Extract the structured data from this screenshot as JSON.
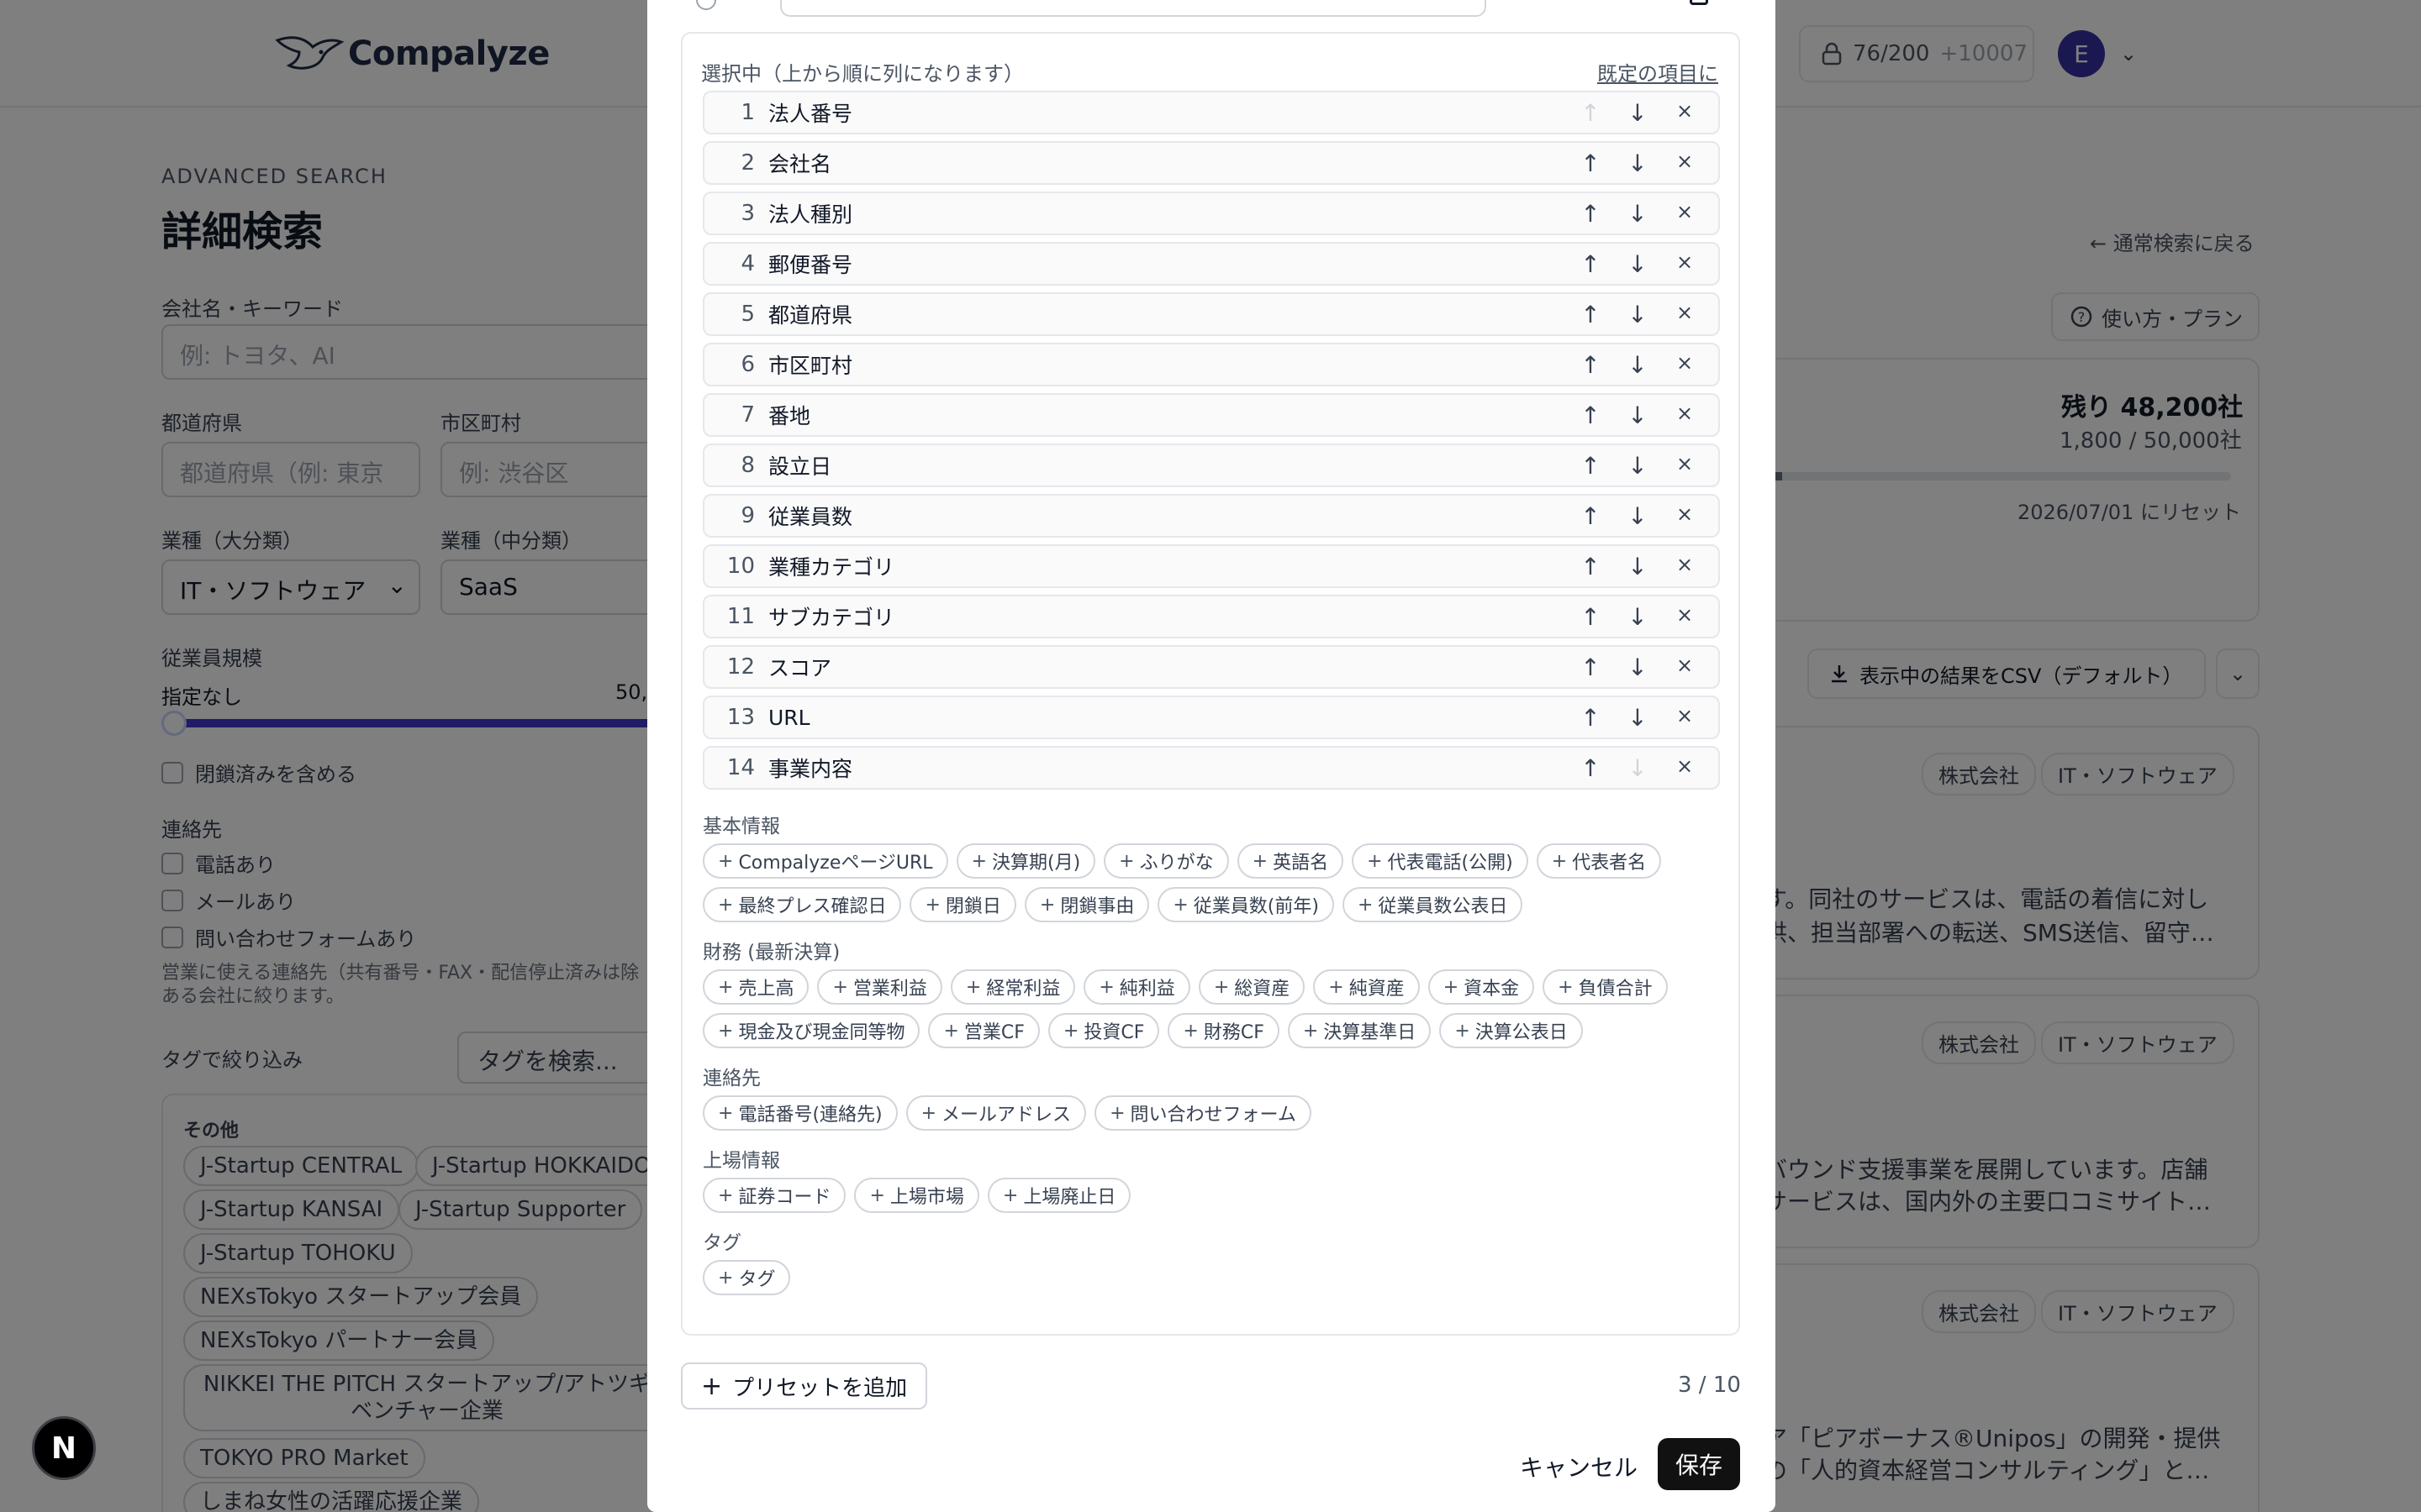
{
  "header": {
    "logo_text": "Compalyze",
    "credits": "76/200",
    "credits_extra": "+10007",
    "avatar_initial": "E"
  },
  "page": {
    "eyebrow": "ADVANCED SEARCH",
    "title": "詳細検索",
    "keyword_label": "会社名・キーワード",
    "keyword_placeholder": "例: トヨタ、AI",
    "pref_label": "都道府県",
    "pref_placeholder": "都道府県（例: 東京",
    "city_label": "市区町村",
    "city_placeholder": "例: 渋谷区",
    "industry_label": "業種（大分類）",
    "industry_value": "IT・ソフトウェア",
    "subindustry_label": "業種（中分類）",
    "subindustry_value": "SaaS",
    "employees_label": "従業員規模",
    "employees_min": "指定なし",
    "employees_max": "50,",
    "include_closed": "閉鎖済みを含める",
    "contact_label": "連絡先",
    "has_phone": "電話あり",
    "has_email": "メールあり",
    "has_form": "問い合わせフォームあり",
    "contact_note_1": "営業に使える連絡先（共有番号・FAX・配信停止済みは除",
    "contact_note_2": "ある会社に絞ります。",
    "tag_filter_label": "タグで絞り込み",
    "tag_search_placeholder": "タグを検索...",
    "tag_group_title": "その他",
    "tags": [
      "J-Startup CENTRAL",
      "J-Startup HOKKAIDO",
      "J-Startup KANSAI",
      "J-Startup Supporter",
      "J-Startup TOHOKU",
      "NEXsTokyo スタートアップ会員",
      "NEXsTokyo パートナー会員",
      "NIKKEI THE PITCH スタートアップ/アトツギベンチャー企業",
      "TOKYO PRO Market",
      "しまね女性の活躍応援企業"
    ],
    "back_link": "← 通常検索に戻る",
    "help_button": "使い方・プラン",
    "remaining": "残り 48,200社",
    "usage": "1,800 / 50,000社",
    "usage_fraction": 0.036,
    "reset_date": "2026/07/01 にリセット",
    "csv_button": "表示中の結果をCSV（デフォルト）",
    "results": [
      {
        "badge1": "株式会社",
        "badge2": "IT・ソフトウェア",
        "line1": "す。同社のサービスは、電話の着信に対し",
        "line2": "供、担当部署への転送、SMS送信、留守…"
      },
      {
        "badge1": "株式会社",
        "badge2": "IT・ソフトウェア",
        "line1": "バウンド支援事業を展開しています。店舗",
        "line2": "サービスは、国内外の主要口コミサイト…"
      },
      {
        "badge1": "株式会社",
        "badge2": "IT・ソフトウェア",
        "line1": "ア「ピアボーナス®Unipos」の開発・提供",
        "line2": "の「人的資本経営コンサルティング」と…"
      }
    ]
  },
  "modal": {
    "selected_heading": "選択中（上から順に列になります）",
    "reset_link": "既定の項目に",
    "up_symbol": "↑",
    "down_symbol": "↓",
    "remove_symbol": "×",
    "selected": [
      {
        "n": "1",
        "label": "法人番号"
      },
      {
        "n": "2",
        "label": "会社名"
      },
      {
        "n": "3",
        "label": "法人種別"
      },
      {
        "n": "4",
        "label": "郵便番号"
      },
      {
        "n": "5",
        "label": "都道府県"
      },
      {
        "n": "6",
        "label": "市区町村"
      },
      {
        "n": "7",
        "label": "番地"
      },
      {
        "n": "8",
        "label": "設立日"
      },
      {
        "n": "9",
        "label": "従業員数"
      },
      {
        "n": "10",
        "label": "業種カテゴリ"
      },
      {
        "n": "11",
        "label": "サブカテゴリ"
      },
      {
        "n": "12",
        "label": "スコア"
      },
      {
        "n": "13",
        "label": "URL"
      },
      {
        "n": "14",
        "label": "事業内容"
      }
    ],
    "groups": [
      {
        "title": "基本情報",
        "items": [
          "CompalyzeページURL",
          "決算期(月)",
          "ふりがな",
          "英語名",
          "代表電話(公開)",
          "代表者名",
          "最終プレス確認日",
          "閉鎖日",
          "閉鎖事由",
          "従業員数(前年)",
          "従業員数公表日"
        ]
      },
      {
        "title": "財務 (最新決算)",
        "items": [
          "売上高",
          "営業利益",
          "経常利益",
          "純利益",
          "総資産",
          "純資産",
          "資本金",
          "負債合計",
          "現金及び現金同等物",
          "営業CF",
          "投資CF",
          "財務CF",
          "決算基準日",
          "決算公表日"
        ]
      },
      {
        "title": "連絡先",
        "items": [
          "電話番号(連絡先)",
          "メールアドレス",
          "問い合わせフォーム"
        ]
      },
      {
        "title": "上場情報",
        "items": [
          "証券コード",
          "上場市場",
          "上場廃止日"
        ]
      },
      {
        "title": "タグ",
        "items": [
          "タグ"
        ]
      }
    ],
    "add_symbol": "+",
    "add_preset": "プリセットを追加",
    "preset_count": "3 / 10",
    "cancel": "キャンセル",
    "save": "保存"
  },
  "dev_badge": "N"
}
